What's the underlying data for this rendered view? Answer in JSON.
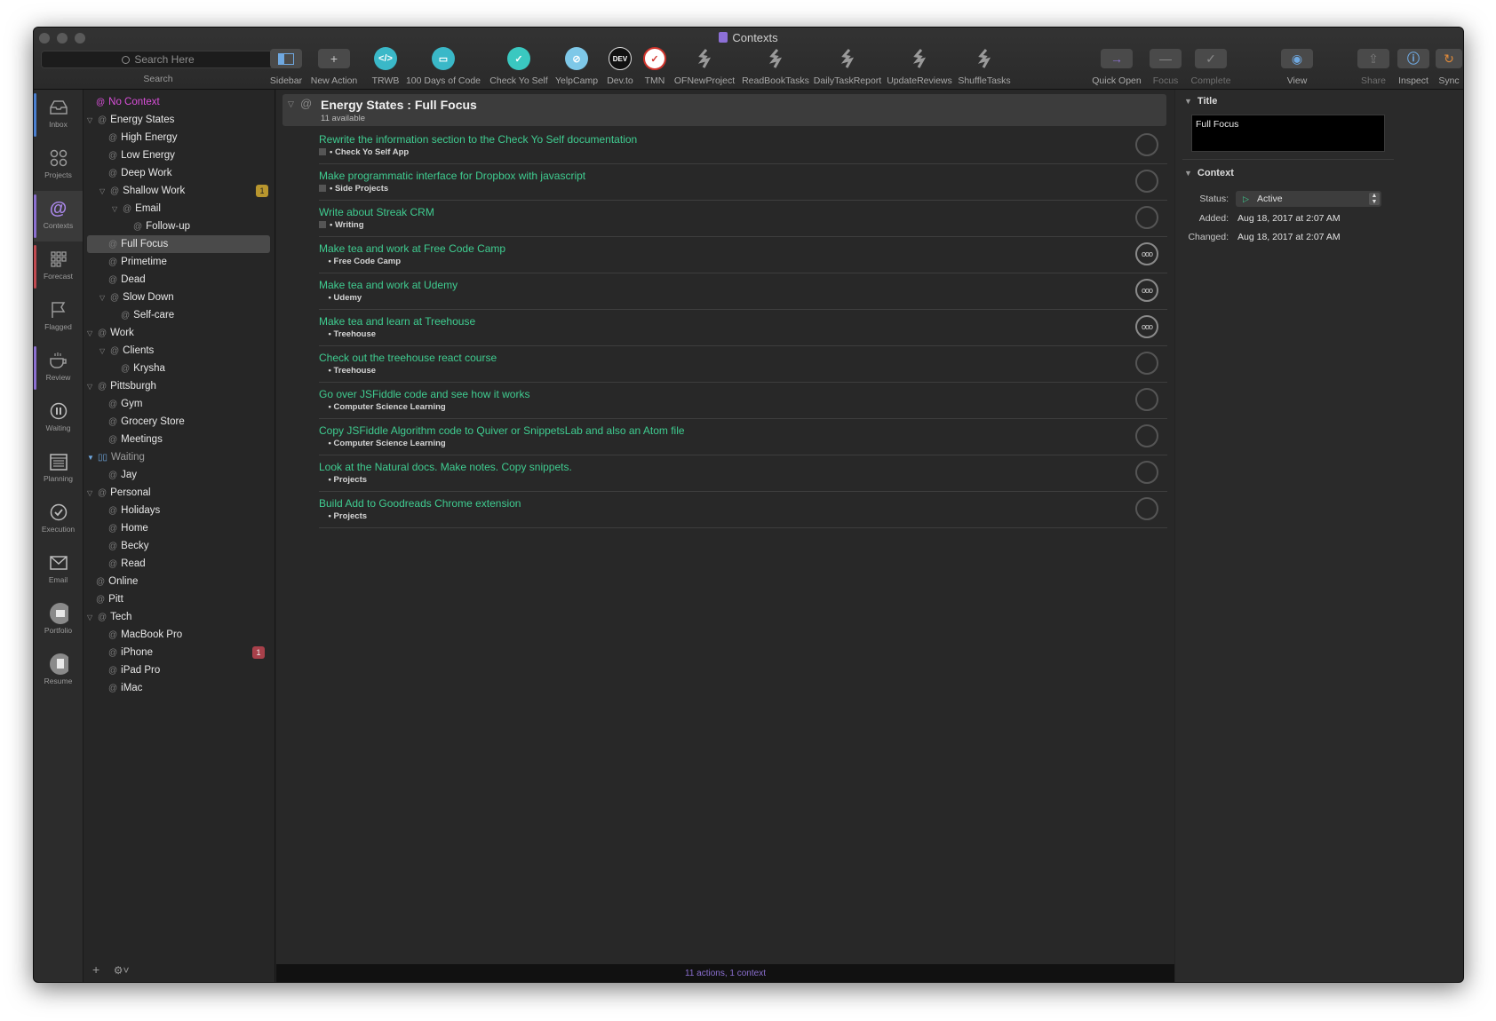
{
  "window": {
    "title": "Contexts"
  },
  "search": {
    "placeholder": "Search Here",
    "label": "Search"
  },
  "toolbar": {
    "sidebar": "Sidebar",
    "new_action": "New Action",
    "trwb": "TRWB",
    "days100": "100 Days of Code",
    "check_yo_self": "Check Yo Self",
    "yelpcamp": "YelpCamp",
    "devto": "Dev.to",
    "devto_glyph": "DEV",
    "tmn": "TMN",
    "ofnewproject": "OFNewProject",
    "readbooktasks": "ReadBookTasks",
    "dailytaskreport": "DailyTaskReport",
    "updatereviews": "UpdateReviews",
    "shuffletasks": "ShuffleTasks",
    "quick_open": "Quick Open",
    "focus": "Focus",
    "complete": "Complete",
    "view": "View",
    "share": "Share",
    "inspect": "Inspect",
    "sync": "Sync"
  },
  "rail": [
    {
      "label": "Inbox",
      "icon": "inbox-icon"
    },
    {
      "label": "Projects",
      "icon": "projects-icon"
    },
    {
      "label": "Contexts",
      "icon": "contexts-icon"
    },
    {
      "label": "Forecast",
      "icon": "forecast-icon"
    },
    {
      "label": "Flagged",
      "icon": "flag-icon"
    },
    {
      "label": "Review",
      "icon": "review-icon"
    },
    {
      "label": "Waiting",
      "icon": "pause-icon"
    },
    {
      "label": "Planning",
      "icon": "calendar-icon"
    },
    {
      "label": "Execution",
      "icon": "checkmark-icon"
    },
    {
      "label": "Email",
      "icon": "mail-icon"
    },
    {
      "label": "Portfolio",
      "icon": "portfolio-icon"
    },
    {
      "label": "Resume",
      "icon": "resume-icon"
    }
  ],
  "sidebar": {
    "items": [
      {
        "label": "No Context"
      },
      {
        "label": "Energy States"
      },
      {
        "label": "High Energy"
      },
      {
        "label": "Low Energy"
      },
      {
        "label": "Deep Work"
      },
      {
        "label": "Shallow Work",
        "badge": "1"
      },
      {
        "label": "Email"
      },
      {
        "label": "Follow-up"
      },
      {
        "label": "Full Focus"
      },
      {
        "label": "Primetime"
      },
      {
        "label": "Dead"
      },
      {
        "label": "Slow Down"
      },
      {
        "label": "Self-care"
      },
      {
        "label": "Work"
      },
      {
        "label": "Clients"
      },
      {
        "label": "Krysha"
      },
      {
        "label": "Pittsburgh"
      },
      {
        "label": "Gym"
      },
      {
        "label": "Grocery Store"
      },
      {
        "label": "Meetings"
      },
      {
        "label": "Waiting"
      },
      {
        "label": "Jay"
      },
      {
        "label": "Personal"
      },
      {
        "label": "Holidays"
      },
      {
        "label": "Home"
      },
      {
        "label": "Becky"
      },
      {
        "label": "Read"
      },
      {
        "label": "Online"
      },
      {
        "label": "Pitt"
      },
      {
        "label": "Tech"
      },
      {
        "label": "MacBook Pro"
      },
      {
        "label": "iPhone",
        "badge": "1"
      },
      {
        "label": "iPad Pro"
      },
      {
        "label": "iMac"
      }
    ],
    "colors": {
      "no_context": "#d84fd8",
      "badge_yellow": "#b8962e",
      "badge_red": "#a8404a"
    }
  },
  "main": {
    "group_title": "Energy States : Full Focus",
    "group_subtitle": "11 available",
    "actions": [
      {
        "title": "Rewrite the information section to the Check Yo Self documentation",
        "project": "Check Yo Self App",
        "more": false
      },
      {
        "title": "Make programmatic interface for Dropbox with javascript",
        "project": "Side Projects",
        "more": false
      },
      {
        "title": "Write about Streak CRM",
        "project": "Writing",
        "more": false
      },
      {
        "title": "Make tea and work at Free Code Camp",
        "project": "Free Code Camp",
        "more": true
      },
      {
        "title": "Make tea and work at Udemy",
        "project": "Udemy",
        "more": true
      },
      {
        "title": "Make tea and learn at Treehouse",
        "project": "Treehouse",
        "more": true
      },
      {
        "title": "Check out the treehouse react course",
        "project": "Treehouse",
        "more": false
      },
      {
        "title": "Go over JSFiddle code and see how it works",
        "project": "Computer Science Learning",
        "more": false
      },
      {
        "title": "Copy JSFiddle Algorithm code to Quiver or SnippetsLab and also an Atom file",
        "project": "Computer Science Learning",
        "more": false
      },
      {
        "title": "Look at the Natural docs. Make notes. Copy snippets.",
        "project": "Projects",
        "more": false
      },
      {
        "title": "Build Add to Goodreads Chrome extension",
        "project": "Projects",
        "more": false
      }
    ],
    "status_text": "11 actions, 1 context",
    "colors": {
      "action_title": "#3fcc90",
      "status": "#8b6fd0"
    }
  },
  "inspector": {
    "title_section": "Title",
    "title_value": "Full Focus",
    "context_section": "Context",
    "status_label": "Status:",
    "status_value": "Active",
    "added_label": "Added:",
    "added_value": "Aug 18, 2017 at 2:07 AM",
    "changed_label": "Changed:",
    "changed_value": "Aug 18, 2017 at 2:07 AM"
  }
}
